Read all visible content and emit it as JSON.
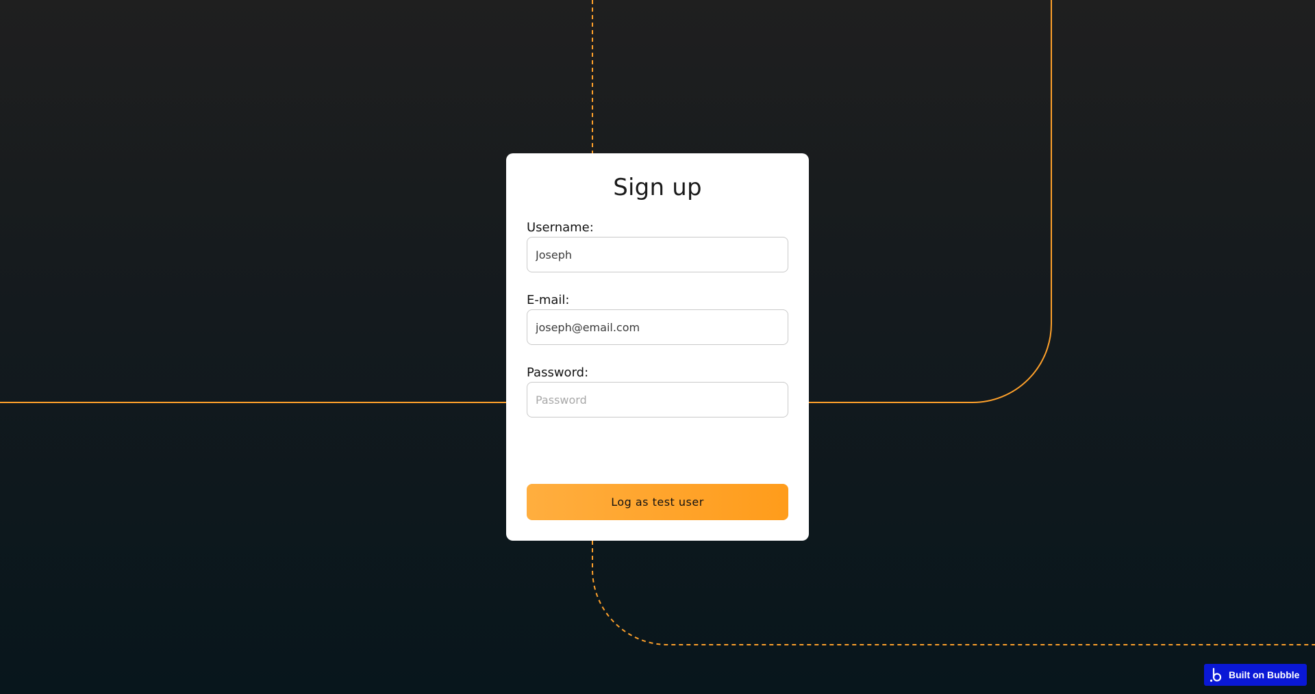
{
  "form": {
    "title": "Sign up",
    "username_label": "Username:",
    "username_value": "Joseph",
    "email_label": "E-mail:",
    "email_value": "joseph@email.com",
    "password_label": "Password:",
    "password_placeholder": "Password",
    "submit_label": "Log as test user"
  },
  "badge": {
    "label": "Built on Bubble",
    "icon": "bubble-logo-icon"
  },
  "colors": {
    "accent": "#ffa12b",
    "badge": "#0a18d6",
    "background_top": "#1f1f1f",
    "background_bottom": "#08161c"
  }
}
